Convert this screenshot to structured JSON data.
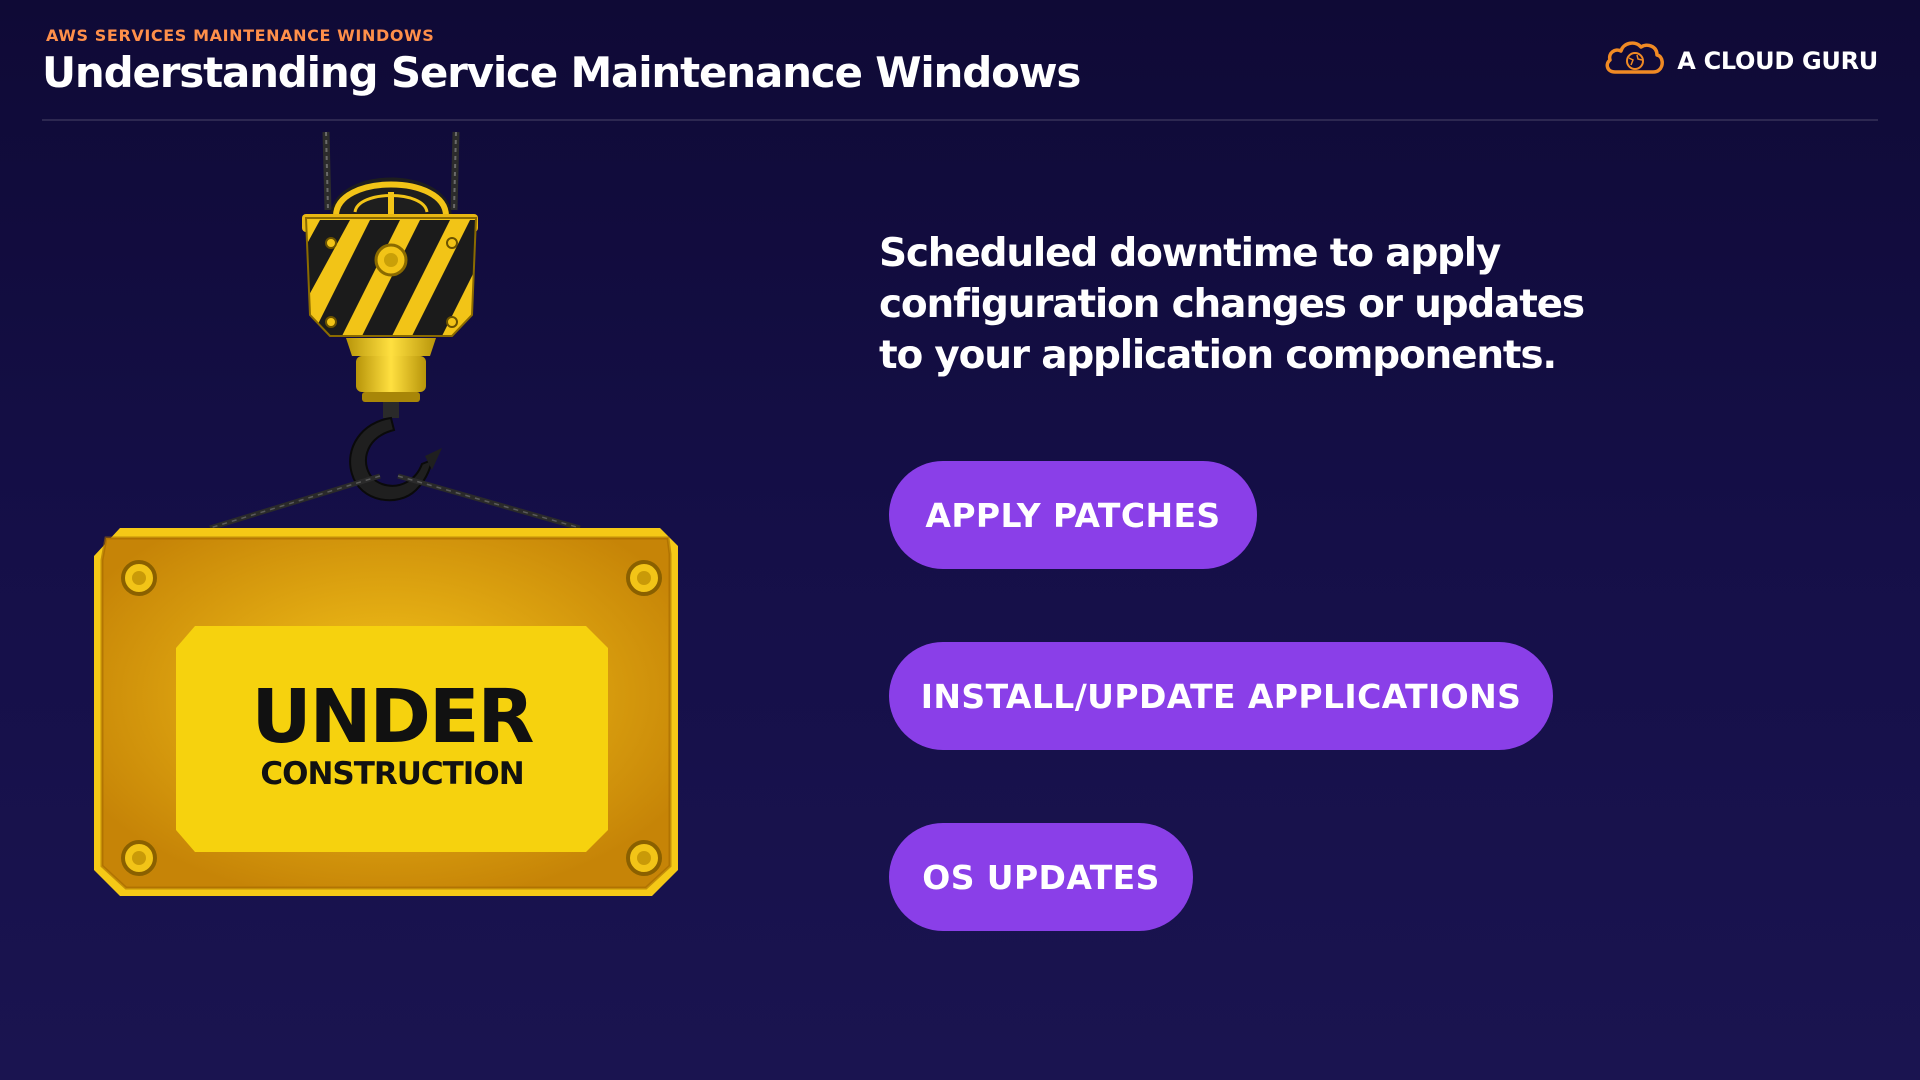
{
  "header": {
    "eyebrow": "AWS SERVICES MAINTENANCE WINDOWS",
    "title": "Understanding Service Maintenance Windows"
  },
  "brand": {
    "logo_icon": "cloud-icon",
    "name": "A CLOUD GURU",
    "logo_color": "#f08a24"
  },
  "illustration": {
    "sign_line1": "UNDER",
    "sign_line2": "CONSTRUCTION",
    "icon": "crane-hook-icon",
    "sign_color": "#f5c916"
  },
  "main": {
    "description": "Scheduled downtime to apply configuration changes or updates to your application components.",
    "items": [
      {
        "label": "APPLY PATCHES"
      },
      {
        "label": "INSTALL/UPDATE APPLICATIONS"
      },
      {
        "label": "OS UPDATES"
      }
    ]
  },
  "colors": {
    "background": "#140e44",
    "accent": "#8a3fe8",
    "eyebrow": "#ff8f4a"
  }
}
